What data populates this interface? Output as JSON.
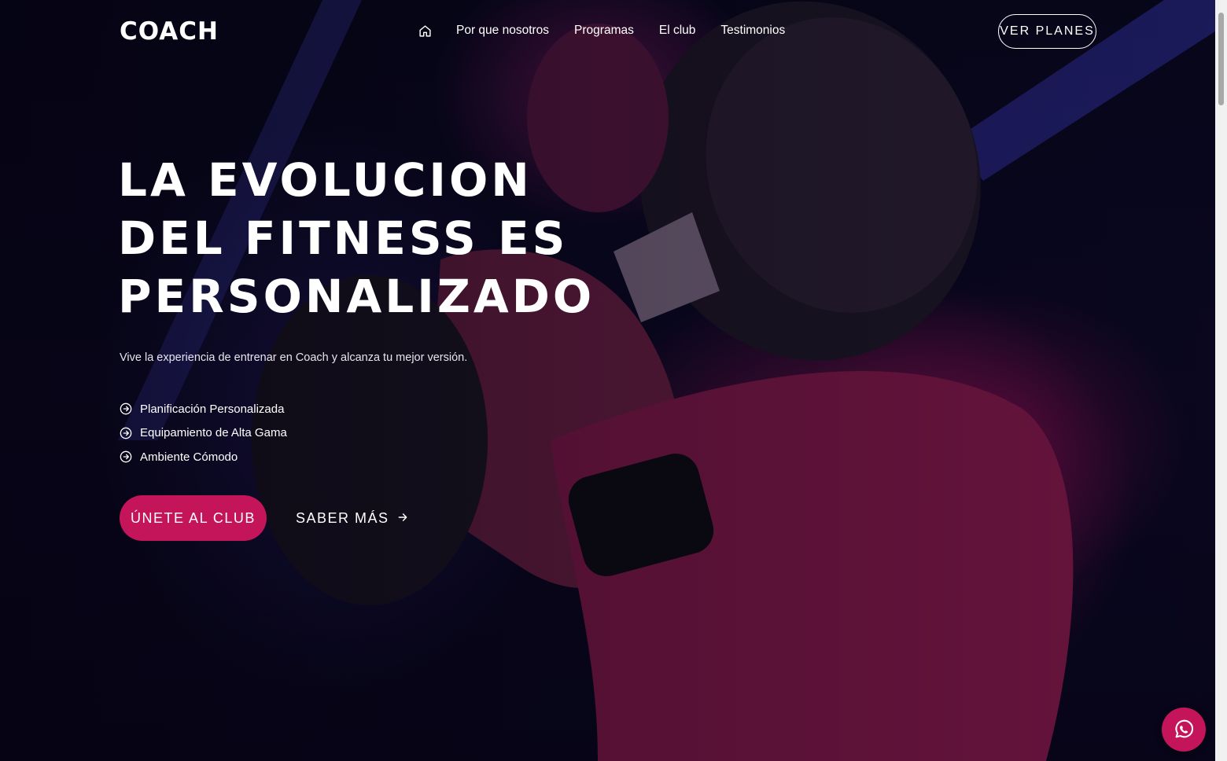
{
  "brand": {
    "logo_text": "COACH"
  },
  "nav": {
    "home_icon": "home-icon",
    "items": [
      {
        "label": "Por que nosotros"
      },
      {
        "label": "Programas"
      },
      {
        "label": "El club"
      },
      {
        "label": "Testimonios"
      }
    ],
    "cta_label": "VER PLANES"
  },
  "hero": {
    "title_lines": [
      "LA EVOLUCION",
      "DEL FITNESS ES",
      "PERSONALIZADO"
    ],
    "subtitle": "Vive la experiencia de entrenar en Coach y alcanza tu mejor versión.",
    "features": [
      {
        "icon": "arrow-circle-right-icon",
        "label": "Planificación Personalizada"
      },
      {
        "icon": "arrow-circle-right-icon",
        "label": "Equipamiento de Alta Gama"
      },
      {
        "icon": "arrow-circle-right-icon",
        "label": "Ambiente Cómodo"
      }
    ],
    "primary_button": "ÚNETE AL CLUB",
    "secondary_button": "SABER MÁS"
  },
  "floating": {
    "whatsapp_icon": "whatsapp-icon"
  },
  "colors": {
    "accent": "#c4155b",
    "background": "#06040f",
    "text": "#ffffff"
  }
}
